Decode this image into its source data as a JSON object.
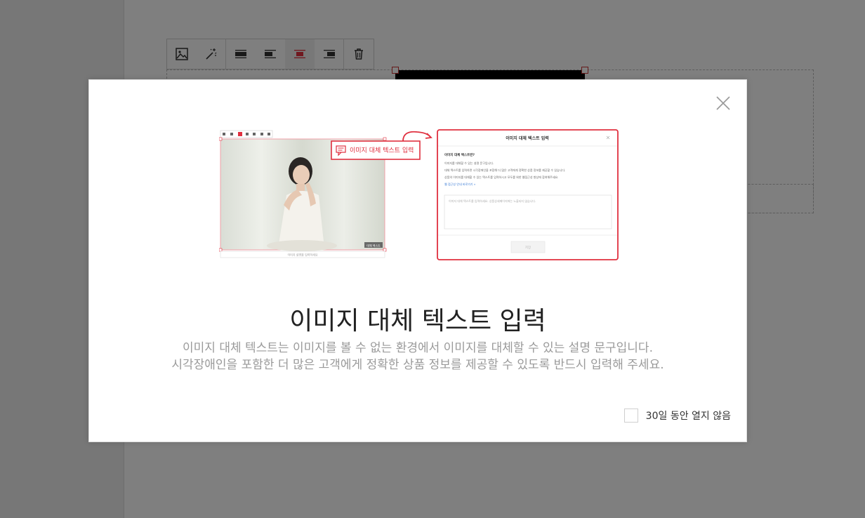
{
  "toolbar": {
    "buttons": [
      {
        "name": "image-icon"
      },
      {
        "name": "magic-wand-icon"
      },
      {
        "name": "align-full-icon"
      },
      {
        "name": "align-left-icon"
      },
      {
        "name": "align-center-icon"
      },
      {
        "name": "align-right-icon"
      },
      {
        "name": "trash-icon"
      }
    ]
  },
  "modal": {
    "title": "이미지 대체 텍스트 입력",
    "description_line1": "이미지 대체 텍스트는 이미지를 볼 수 없는 환경에서 이미지를 대체할 수 있는 설명 문구입니다.",
    "description_line2": "시각장애인을 포함한 더 많은 고객에게 정확한 상품 정보를 제공할 수 있도록 반드시 입력해 주세요.",
    "dont_show_label": "30일 동안 열지 않음",
    "illustration": {
      "callout_label": "이미지 대체 텍스트 입력",
      "dialog_title": "이미지 대체 텍스트 입력",
      "dialog_heading": "이미지 대체 텍스트란?",
      "dialog_line1": "이미지를 대체할 수 있는 설명 문구입니다.",
      "dialog_line2": "대체 텍스트를 입력하면 시각장애인을 포함해 더 많은 고객에게 정확한 상품 정보를 제공할 수 있습니다.",
      "dialog_line3": "상품의 이미지를 대체할 수 있는 텍스트를 입력하시고 모두를 위한 웹접근성 향상에 참여해주세요.",
      "dialog_link": "웹 접근성 안내 바로가기 »",
      "dialog_placeholder": "이미지 대체 텍스트를 입력하세요. 상품상세페이지에는 노출되지 않습니다.",
      "dialog_button": "저장",
      "caption": "이미지 설명을 입력하세요",
      "image_badge": "대체 텍스트"
    }
  },
  "colors": {
    "accent": "#e0303f",
    "overlay": "#000000"
  }
}
